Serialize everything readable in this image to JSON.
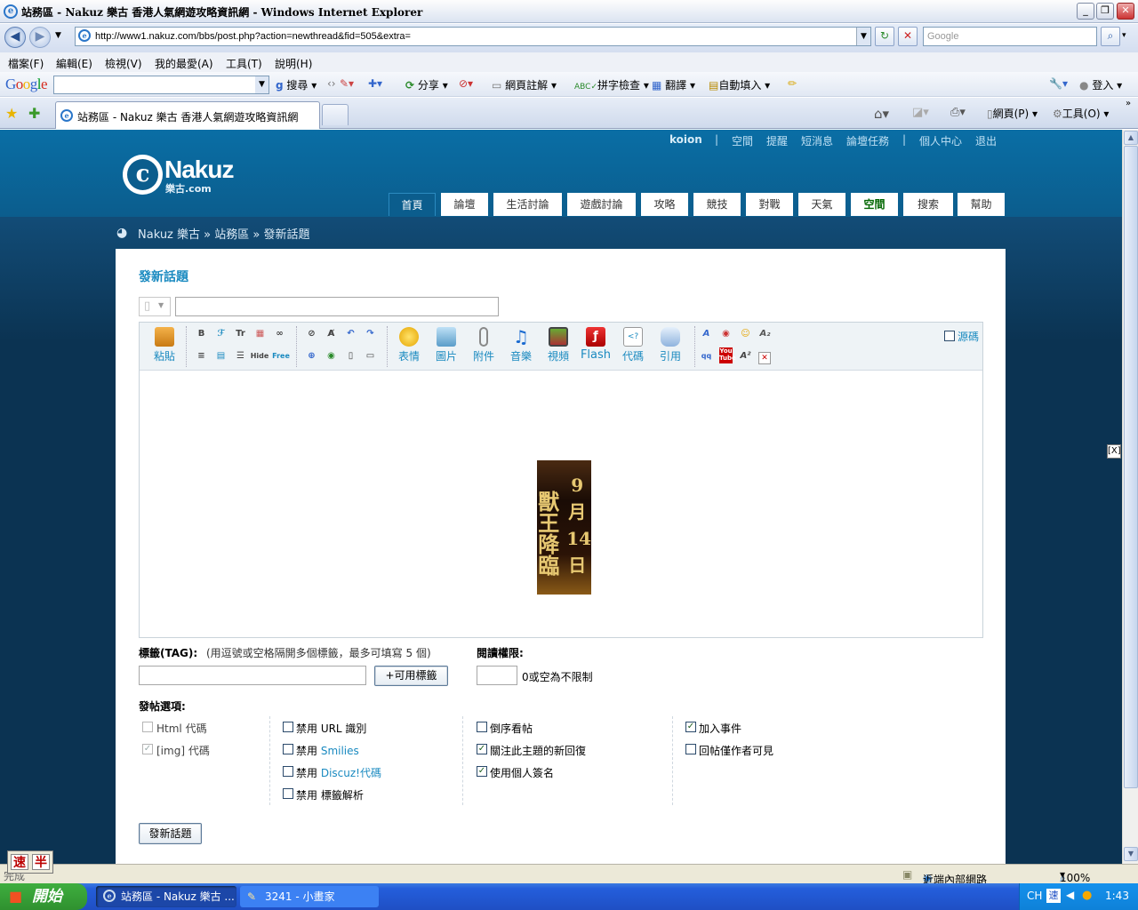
{
  "window": {
    "title": "站務區 - Nakuz 樂古 香港人氣網遊攻略資訊網 - Windows Internet Explorer",
    "min": "_",
    "max": "❐",
    "close": "✕"
  },
  "address": {
    "url": "http://www1.nakuz.com/bbs/post.php?action=newthread&fid=505&extra=",
    "search_placeholder": "Google"
  },
  "menu": [
    "檔案(F)",
    "編輯(E)",
    "檢視(V)",
    "我的最愛(A)",
    "工具(T)",
    "說明(H)"
  ],
  "google_toolbar": {
    "logo": "Google",
    "items": [
      "搜尋 ▾",
      "分享 ▾",
      "網頁註解 ▾",
      "拼字檢查 ▾",
      "翻譯 ▾",
      "自動填入 ▾"
    ],
    "login": "登入 ▾"
  },
  "tabs": {
    "active_title": "站務區 - Nakuz 樂古 香港人氣網遊攻略資訊網",
    "right_tools": [
      "網頁(P) ▾",
      "工具(O) ▾"
    ]
  },
  "site": {
    "logo_text": "Nakuz",
    "logo_sub": "樂古.com",
    "user": "koion",
    "user_links": [
      "空間",
      "提醒",
      "短消息",
      "論壇任務",
      "個人中心",
      "退出"
    ],
    "nav": [
      "首頁",
      "論壇",
      "生活討論",
      "遊戲討論",
      "攻略",
      "競技",
      "對戰",
      "天氣",
      "空間",
      "搜索",
      "幫助"
    ],
    "breadcrumb": "Nakuz 樂古 » 站務區 » 發新話題"
  },
  "form": {
    "heading": "發新話題",
    "subject_value": "",
    "source_label": "源碼",
    "toolbar_big": [
      "粘貼",
      "表情",
      "圖片",
      "附件",
      "音樂",
      "視頻",
      "Flash",
      "代碼",
      "引用"
    ],
    "banner_left": "獸王降臨",
    "banner_right_1": "9",
    "banner_right_2": "月",
    "banner_right_3": "14",
    "banner_right_4": "日",
    "tag_label": "標籤(TAG):",
    "tag_hint": "(用逗號或空格隔開多個標籤，最多可填寫 5 個)",
    "tag_value": "",
    "tag_button": "+可用標籤",
    "read_label": "閱讀權限:",
    "read_value": "",
    "read_hint": "0或空為不限制",
    "options_label": "發帖選項:",
    "options": {
      "html": "Html 代碼",
      "img": "[img] 代碼",
      "url_prefix": "禁用 URL 識別",
      "smilies_prefix": "禁用 ",
      "smilies_link": "Smilies",
      "discuz_prefix": "禁用 ",
      "discuz_link": "Discuz!代碼",
      "tagparse": "禁用 標籤解析",
      "reverse": "倒序看帖",
      "follow": "關注此主題的新回復",
      "sig": "使用個人簽名",
      "event": "加入事件",
      "author_only": "回帖僅作者可見"
    },
    "checked": {
      "html": false,
      "img": true,
      "url": false,
      "smilies": false,
      "discuz": false,
      "tagparse": false,
      "reverse": false,
      "follow": true,
      "sig": true,
      "event": true,
      "author_only": false
    },
    "submit": "發新話題"
  },
  "statusbar": {
    "left": "完成",
    "zone": "近端內部網路",
    "zoom": "100%"
  },
  "taskbar": {
    "start": "開始",
    "tasks": [
      "站務區 - Nakuz 樂古 ...",
      "3241 - 小畫家"
    ],
    "lang": "CH",
    "time": "1:43"
  },
  "ime": [
    "速",
    "半"
  ],
  "colors": {
    "site_blue": "#0a6ea5",
    "link": "#1a8ac0",
    "nav_green": "#006600"
  }
}
